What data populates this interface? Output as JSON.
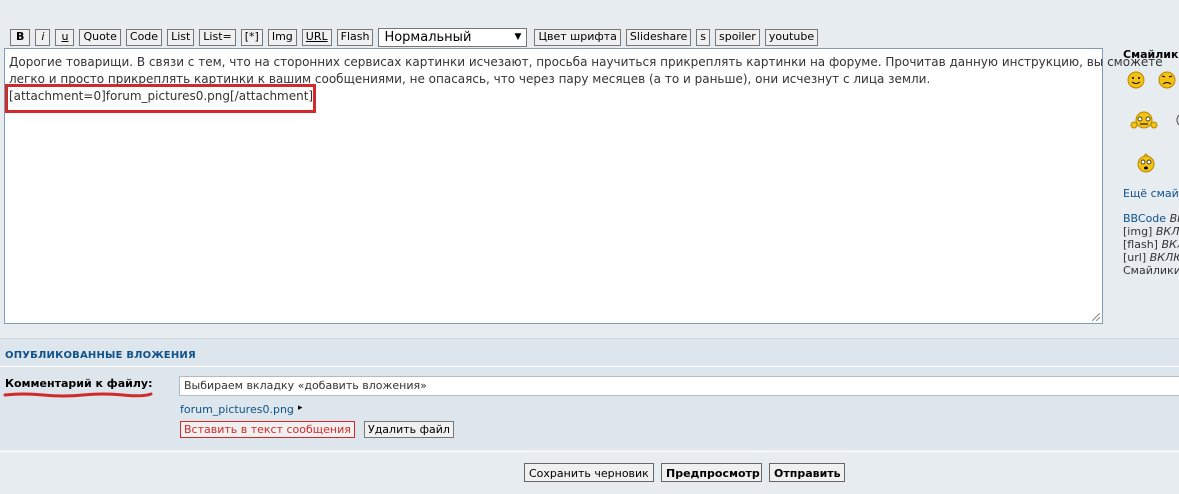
{
  "toolbar": {
    "bold": "B",
    "italic": "i",
    "underline": "u",
    "quote": "Quote",
    "code": "Code",
    "list": "List",
    "list_ordered": "List=",
    "list_item": "[*]",
    "img": "Img",
    "url": "URL",
    "flash": "Flash",
    "font_size_selected": "Нормальный",
    "font_color": "Цвет шрифта",
    "slideshare": "Slideshare",
    "s": "s",
    "spoiler": "spoiler",
    "youtube": "youtube"
  },
  "message": {
    "line1": "Дорогие товарищи. В связи с тем, что на сторонних сервисах картинки исчезают, просьба научиться прикреплять картинки на форуме. Прочитав данную инструкцию, вы сможете",
    "line2": "легко и просто прикреплять картинки к вашим сообщениями, не опасаясь, что через пару месяцев (а то и раньше), они исчезнут с лица земли.",
    "attachment_tag": "[attachment=0]forum_pictures0.png[/attachment]"
  },
  "smilies": {
    "title": "Смайлики",
    "more": "Ещё смайлики",
    "icons": [
      "smile-icon",
      "sad-icon",
      "bored-icon",
      "cool-icon",
      "confused-icon"
    ]
  },
  "bbcode_info": {
    "bbcode_label": "BBCode",
    "bbcode_value": "ВКЛЮЧЁН",
    "img_label": "[img]",
    "img_value": "ВКЛЮЧЁН",
    "flash_label": "[flash]",
    "flash_value": "ВКЛЮЧЁН",
    "url_label": "[url]",
    "url_value": "ВКЛЮЧЁН",
    "smilies_label": "Смайлики"
  },
  "attachments": {
    "title": "ОПУБЛИКОВАННЫЕ ВЛОЖЕНИЯ",
    "comment_label": "Комментарий к файлу:",
    "comment_value": "Выбираем вкладку «добавить вложения»",
    "file_name": "forum_pictures0.png",
    "insert_button": "Вставить в текст сообщения",
    "delete_button": "Удалить файл"
  },
  "actions": {
    "save_draft": "Сохранить черновик",
    "preview": "Предпросмотр",
    "submit": "Отправить"
  },
  "colors": {
    "highlight": "#d12a2a",
    "link": "#105289",
    "panel_bg": "#dde6ec",
    "page_bg": "#e6ecf0",
    "smiley_yellow": "#f5c211"
  }
}
